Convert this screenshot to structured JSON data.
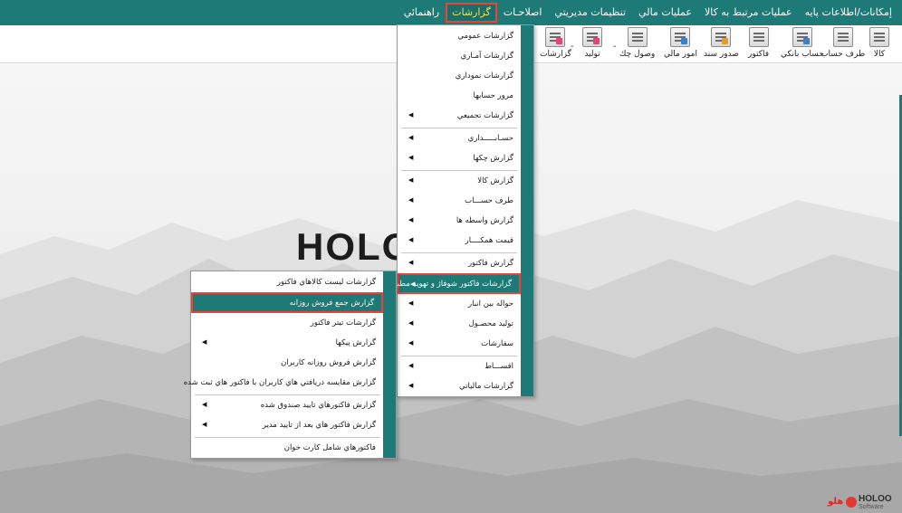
{
  "menubar": {
    "items": [
      {
        "label": "إمكانات/اطلاعات پايه",
        "active": false
      },
      {
        "label": "عمليات مرتبط به كالا",
        "active": false
      },
      {
        "label": "عمليات مالي",
        "active": false
      },
      {
        "label": "تنظيمات مديريتي",
        "active": false
      },
      {
        "label": "اصلاحـات",
        "active": false
      },
      {
        "label": "گزارشات",
        "active": true
      },
      {
        "label": "راهنمائي",
        "active": false
      }
    ]
  },
  "toolbar": {
    "items": [
      {
        "label": "كالا",
        "icon": "box-icon",
        "accent": ""
      },
      {
        "label": "طرف حساب",
        "icon": "person-icon",
        "accent": ""
      },
      {
        "label": "حساب بانكي",
        "icon": "bank-card-icon",
        "accent": "blue"
      },
      {
        "label": "فاكتور",
        "icon": "invoice-icon",
        "accent": ""
      },
      {
        "label": "صدور سند",
        "icon": "document-icon",
        "accent": "orange"
      },
      {
        "label": "امور مالي",
        "icon": "finance-icon",
        "accent": "blue"
      },
      {
        "label": "وصول چك",
        "icon": "cheque-icon",
        "accent": ""
      },
      {
        "label": "توليد",
        "icon": "production-icon",
        "accent": "pink"
      },
      {
        "label": "گزارشات",
        "icon": "report-icon",
        "accent": "pink"
      }
    ],
    "separator": "-"
  },
  "background": {
    "logo_text": "HOLO"
  },
  "brand": {
    "fa": "هلو",
    "name": "HOLOO",
    "sub": "Software",
    "accent": "#e23a2f"
  },
  "reports_menu": {
    "items": [
      {
        "label": "گزارشات عمومي",
        "arrow": false
      },
      {
        "label": "گزارشات آمـاري",
        "arrow": false
      },
      {
        "label": "گزارشات نموداري",
        "arrow": false
      },
      {
        "label": "مرور حسابها",
        "arrow": false
      },
      {
        "label": "گزارشات تجميعي",
        "arrow": true
      },
      {
        "label": "حسـابـــــداري",
        "arrow": true
      },
      {
        "label": "گزارش چكها",
        "arrow": true
      },
      {
        "label": "گزارش كالا",
        "arrow": true
      },
      {
        "label": "طرف حســـاب",
        "arrow": true
      },
      {
        "label": "گزارش واسطه ها",
        "arrow": true
      },
      {
        "label": "قيمت همكــــار",
        "arrow": true
      },
      {
        "label": "گزارش فاكتور",
        "arrow": true
      },
      {
        "label": "گزارشات فاكتور شوفاژ و تهويه مطبوع",
        "arrow": true
      },
      {
        "label": "حواله بين انبار",
        "arrow": true
      },
      {
        "label": "توليد محصـول",
        "arrow": true
      },
      {
        "label": "سفارشات",
        "arrow": true
      },
      {
        "label": "اقســـاط",
        "arrow": true
      },
      {
        "label": "گزارشات مالياتي",
        "arrow": true
      }
    ]
  },
  "submenu": {
    "items": [
      {
        "label": "گزارشات ليست كالاهاي فاكتور",
        "arrow": false
      },
      {
        "label": "گزارش جمع فروش روزانه",
        "arrow": false
      },
      {
        "label": "گزارشات تيتر فاكتور",
        "arrow": false
      },
      {
        "label": "گزارش پيكها",
        "arrow": true
      },
      {
        "label": "گزارش فروش روزانه كاربران",
        "arrow": false
      },
      {
        "label": "گزارش مقايسه دريافتي هاي  كاربران با فاكتور هاي ثبت شده",
        "arrow": false
      },
      {
        "label": "گزارش فاكتورهاي تاييد صندوق شده",
        "arrow": true
      },
      {
        "label": "گزارش فاكتور هاي بعد از تاييد مدير",
        "arrow": true
      },
      {
        "label": "فاكتورهاي شامل كارت خوان",
        "arrow": false
      }
    ]
  },
  "colors": {
    "primary": "#1e7a76",
    "highlight_border": "#e8443c",
    "active_text": "#f3e35a"
  }
}
